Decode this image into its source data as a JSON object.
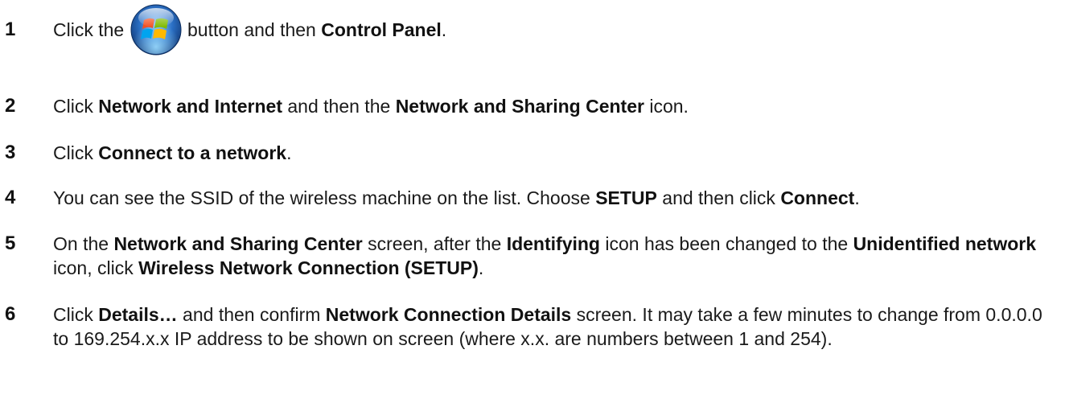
{
  "steps": [
    {
      "number": "1",
      "segments": [
        {
          "t": "Click the ",
          "b": false
        },
        {
          "icon": "windows-start-orb-icon"
        },
        {
          "t": " button and then ",
          "b": false
        },
        {
          "t": "Control Panel",
          "b": true
        },
        {
          "t": ".",
          "b": false
        }
      ]
    },
    {
      "number": "2",
      "segments": [
        {
          "t": "Click ",
          "b": false
        },
        {
          "t": "Network and Internet",
          "b": true
        },
        {
          "t": " and then the ",
          "b": false
        },
        {
          "t": "Network and Sharing Center",
          "b": true
        },
        {
          "t": " icon.",
          "b": false
        }
      ]
    },
    {
      "number": "3",
      "segments": [
        {
          "t": "Click ",
          "b": false
        },
        {
          "t": "Connect to a network",
          "b": true
        },
        {
          "t": ".",
          "b": false
        }
      ]
    },
    {
      "number": "4",
      "segments": [
        {
          "t": "You can see the SSID of the wireless machine on the list. Choose ",
          "b": false
        },
        {
          "t": "SETUP",
          "b": true
        },
        {
          "t": " and then click ",
          "b": false
        },
        {
          "t": "Connect",
          "b": true
        },
        {
          "t": ".",
          "b": false
        }
      ]
    },
    {
      "number": "5",
      "segments": [
        {
          "t": "On the ",
          "b": false
        },
        {
          "t": "Network and Sharing Center",
          "b": true
        },
        {
          "t": " screen, after the ",
          "b": false
        },
        {
          "t": "Identifying",
          "b": true
        },
        {
          "t": " icon has been changed to the ",
          "b": false
        },
        {
          "t": "Unidentified network",
          "b": true
        },
        {
          "t": " icon, click ",
          "b": false
        },
        {
          "t": "Wireless Network Connection (SETUP)",
          "b": true
        },
        {
          "t": ".",
          "b": false
        }
      ]
    },
    {
      "number": "6",
      "segments": [
        {
          "t": "Click ",
          "b": false
        },
        {
          "t": "Details…",
          "b": true
        },
        {
          "t": " and then confirm ",
          "b": false
        },
        {
          "t": "Network Connection Details",
          "b": true
        },
        {
          "t": " screen. It may take a few minutes to change from 0.0.0.0 to 169.254.x.x IP address to be shown on screen (where x.x. are numbers between 1 and 254).",
          "b": false
        }
      ]
    }
  ]
}
